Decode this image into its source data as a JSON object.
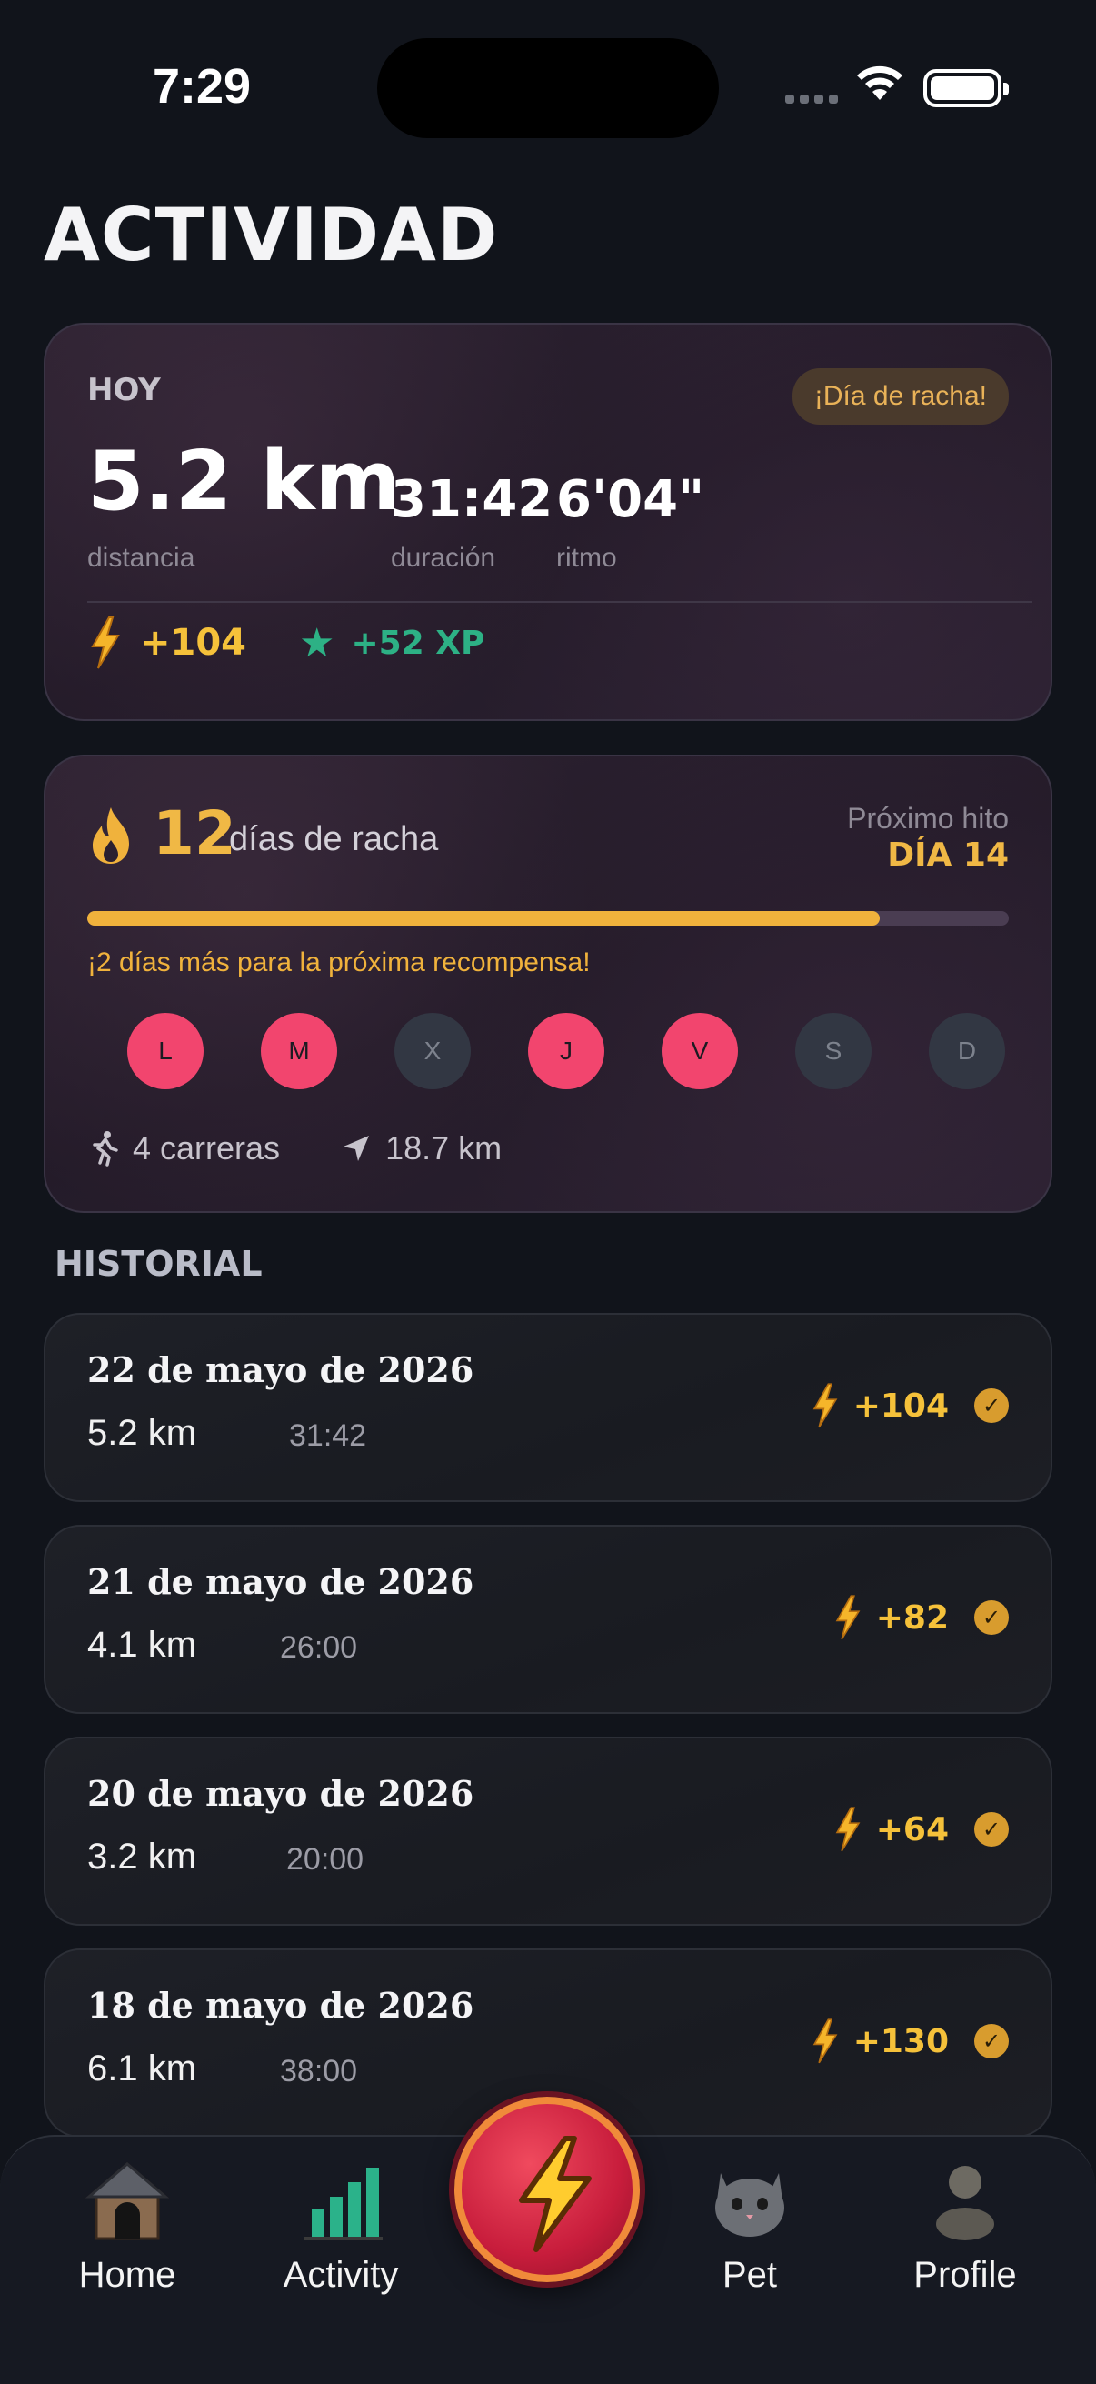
{
  "status_bar": {
    "time": "7:29"
  },
  "page_title": "ACTIVIDAD",
  "today": {
    "label": "HOY",
    "badge": "¡Día de racha!",
    "distance": "5.2 km",
    "distance_label": "distancia",
    "duration": "31:42",
    "duration_label": "duración",
    "pace": "6'04\"",
    "pace_label": "ritmo",
    "reward_points": "+104",
    "reward_xp": "+52 XP"
  },
  "streak": {
    "count": "12",
    "text": "días de racha",
    "milestone_label": "Próximo hito",
    "milestone_value": "DÍA 14",
    "progress_fraction": 0.86,
    "message": "¡2 días más para la próxima recompensa!",
    "days": [
      {
        "letter": "L",
        "done": true
      },
      {
        "letter": "M",
        "done": true
      },
      {
        "letter": "X",
        "done": false
      },
      {
        "letter": "J",
        "done": true
      },
      {
        "letter": "V",
        "done": true
      },
      {
        "letter": "S",
        "done": false
      },
      {
        "letter": "D",
        "done": false
      }
    ],
    "runs": "4 carreras",
    "total_distance": "18.7 km"
  },
  "history_title": "HISTORIAL",
  "history": [
    {
      "date": "22 de mayo de 2026",
      "distance": "5.2 km",
      "duration": "31:42",
      "points": "+104"
    },
    {
      "date": "21 de mayo de 2026",
      "distance": "4.1 km",
      "duration": "26:00",
      "points": "+82"
    },
    {
      "date": "20 de mayo de 2026",
      "distance": "3.2 km",
      "duration": "20:00",
      "points": "+64"
    },
    {
      "date": "18 de mayo de 2026",
      "distance": "6.1 km",
      "duration": "38:00",
      "points": "+130"
    }
  ],
  "tabs": {
    "home": "Home",
    "activity": "Activity",
    "pet": "Pet",
    "profile": "Profile"
  },
  "colors": {
    "background": "#11141b",
    "accent_gold": "#f0b845",
    "accent_pink": "#f2456e",
    "accent_green": "#2db185"
  }
}
